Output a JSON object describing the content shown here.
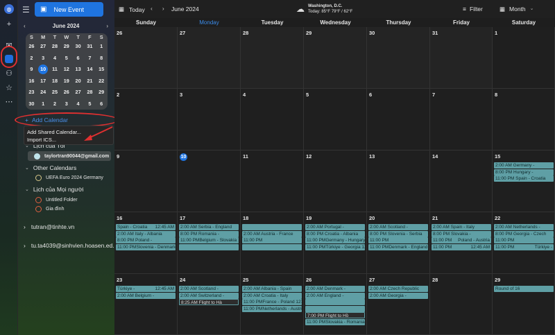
{
  "sidebar": {
    "new_event": "New Event",
    "mini_month": "June 2024",
    "mini_prev": "‹",
    "mini_next": "›",
    "dow": [
      "S",
      "M",
      "T",
      "W",
      "T",
      "F",
      "S"
    ],
    "days": [
      "26",
      "27",
      "28",
      "29",
      "30",
      "31",
      "1",
      "2",
      "3",
      "4",
      "5",
      "6",
      "7",
      "8",
      "9",
      "10",
      "11",
      "12",
      "13",
      "14",
      "15",
      "16",
      "17",
      "18",
      "19",
      "20",
      "21",
      "22",
      "23",
      "24",
      "25",
      "26",
      "27",
      "28",
      "29",
      "30",
      "1",
      "2",
      "3",
      "4",
      "5",
      "6"
    ],
    "add_calendar": "Add Calendar",
    "menu": [
      "Add Shared Calendar...",
      "Import ICS..."
    ],
    "section_mine": "Lịch của Tôi",
    "my_calendar": "taylortran90044@gmail.com",
    "section_other": "Other Calendars",
    "other_calendar": "UEFA Euro 2024 Germany",
    "section_everyone": "Lịch của Mọi người",
    "everyone_items": [
      "Untitled Folder",
      "Gia đình"
    ],
    "account1": "tutran@tinhte.vn",
    "account2": "tu.ta4039@sinhvien.hoasen.ed..."
  },
  "toolbar": {
    "today": "Today",
    "month_label": "June 2024",
    "weather_city": "Washington, D.C.",
    "weather_today": "Today: 85°F 79°F / 62°F",
    "filter": "Filter",
    "view": "Month"
  },
  "calendar": {
    "weekdays": [
      "Sunday",
      "Monday",
      "Tuesday",
      "Wednesday",
      "Thursday",
      "Friday",
      "Saturday"
    ],
    "weeks": [
      [
        {
          "d": "26",
          "ev": []
        },
        {
          "d": "27",
          "ev": []
        },
        {
          "d": "28",
          "ev": []
        },
        {
          "d": "29",
          "ev": []
        },
        {
          "d": "30",
          "ev": []
        },
        {
          "d": "31",
          "ev": []
        },
        {
          "d": "1",
          "ev": []
        }
      ],
      [
        {
          "d": "2",
          "ev": []
        },
        {
          "d": "3",
          "ev": []
        },
        {
          "d": "4",
          "ev": []
        },
        {
          "d": "5",
          "ev": []
        },
        {
          "d": "6",
          "ev": []
        },
        {
          "d": "7",
          "ev": []
        },
        {
          "d": "8",
          "ev": []
        }
      ],
      [
        {
          "d": "9",
          "ev": []
        },
        {
          "d": "10",
          "today": true,
          "ev": []
        },
        {
          "d": "11",
          "ev": []
        },
        {
          "d": "12",
          "ev": []
        },
        {
          "d": "13",
          "ev": []
        },
        {
          "d": "14",
          "ev": []
        },
        {
          "d": "15",
          "ev": [
            [
              "2:00 AM  Germany -",
              ""
            ],
            [
              "8:00 PM  Hungary -",
              ""
            ],
            [
              "11:00 PM  Spain - Croatia",
              ""
            ]
          ]
        }
      ],
      [
        {
          "d": "16",
          "ev": [
            [
              "Spain - Croatia",
              "12:45 AM"
            ],
            [
              "2:00 AM  Italy - Albania",
              ""
            ],
            [
              "8:00 PM  Poland -",
              ""
            ],
            [
              "11:00 PM",
              "Slovenia - Denmark  12:45 AM"
            ]
          ]
        },
        {
          "d": "17",
          "ev": [
            [
              "2:00 AM  Serbia - England",
              ""
            ],
            [
              "8:00 PM  Romania -",
              ""
            ],
            [
              "11:00 PM",
              "Belgium - Slovakia  12:45 AM"
            ],
            [
              "",
              ""
            ]
          ]
        },
        {
          "d": "18",
          "ev": [
            [
              "",
              ""
            ],
            [
              "2:00 AM  Austria - France",
              ""
            ],
            [
              "11:00 PM",
              ""
            ],
            [
              "",
              ""
            ]
          ]
        },
        {
          "d": "19",
          "ev": [
            [
              "2:00 AM  Portugal -",
              ""
            ],
            [
              "8:00 PM  Croatia - Albania",
              ""
            ],
            [
              "11:00 PM",
              "Germany - Hungary"
            ],
            [
              "11:00 PM",
              "Türkiye - Georgia  12:45 AM"
            ]
          ]
        },
        {
          "d": "20",
          "ev": [
            [
              "2:00 AM  Scotland -",
              ""
            ],
            [
              "8:00 PM  Slovenia - Serbia",
              ""
            ],
            [
              "11:00 PM",
              ""
            ],
            [
              "11:00 PM",
              "Denmark - England"
            ]
          ]
        },
        {
          "d": "21",
          "ev": [
            [
              "2:00 AM  Spain - Italy",
              ""
            ],
            [
              "8:00 PM  Slovakia -",
              ""
            ],
            [
              "11:00 PM",
              "Poland - Austria"
            ],
            [
              "11:00 PM",
              "12:45 AM"
            ]
          ]
        },
        {
          "d": "22",
          "ev": [
            [
              "2:00 AM  Netherlands -",
              ""
            ],
            [
              "8:00 PM  Georgia - Czech",
              ""
            ],
            [
              "11:00 PM",
              ""
            ],
            [
              "11:00 PM",
              "Türkiye -"
            ]
          ]
        }
      ],
      [
        {
          "d": "23",
          "ev": [
            [
              "Türkiye -",
              "12:45 AM"
            ],
            [
              "2:00 AM  Belgium -",
              ""
            ]
          ]
        },
        {
          "d": "24",
          "ev": [
            [
              "2:00 AM  Scotland -",
              ""
            ],
            [
              "2:00 AM  Switzerland -",
              ""
            ],
            [
              "8:25 AM  Flight to Hà",
              ""
            ]
          ]
        },
        {
          "d": "25",
          "ev": [
            [
              "2:00 AM  Albania - Spain",
              ""
            ],
            [
              "2:00 AM  Croatia - Italy",
              ""
            ],
            [
              "11:00 PM",
              "France - Poland  12:45 AM"
            ],
            [
              "11:00 PM",
              "Netherlands - Austria  12:45 AM"
            ]
          ]
        },
        {
          "d": "26",
          "ev": [
            [
              "2:00 AM  Denmark -",
              ""
            ],
            [
              "2:00 AM  England -",
              ""
            ],
            [
              "",
              ""
            ],
            [
              "",
              ""
            ],
            [
              "7:00 PM  Flight to Hồ",
              ""
            ],
            [
              "11:00 PM",
              "Slovakia - Romania  12:45 AM"
            ]
          ]
        },
        {
          "d": "27",
          "ev": [
            [
              "2:00 AM  Czech Republic",
              ""
            ],
            [
              "2:00 AM  Georgia -",
              ""
            ]
          ]
        },
        {
          "d": "28",
          "ev": []
        },
        {
          "d": "29",
          "ev": [
            [
              "Round of 16",
              ""
            ]
          ]
        }
      ]
    ]
  }
}
